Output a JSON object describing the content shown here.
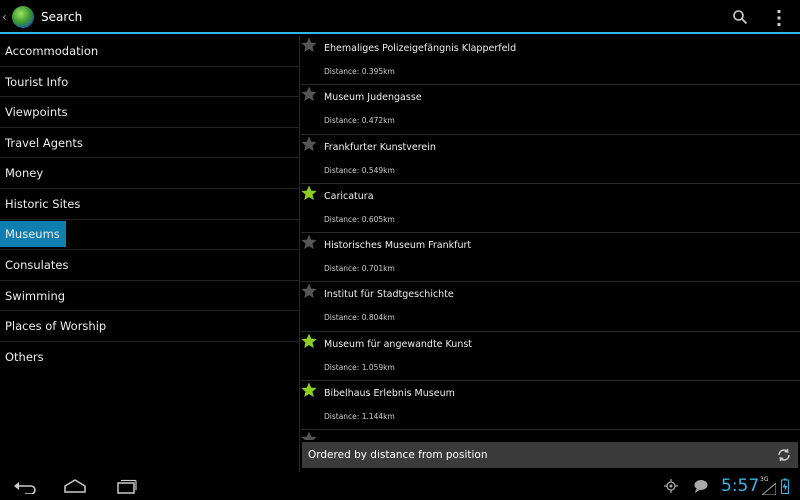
{
  "actionbar": {
    "title": "Search",
    "icons": [
      "up-chevron-icon",
      "globe-logo-icon",
      "search-icon",
      "overflow-menu-icon"
    ]
  },
  "categories": [
    {
      "label": "Accommodation",
      "selected": false
    },
    {
      "label": "Tourist Info",
      "selected": false
    },
    {
      "label": "Viewpoints",
      "selected": false
    },
    {
      "label": "Travel Agents",
      "selected": false
    },
    {
      "label": "Money",
      "selected": false
    },
    {
      "label": "Historic Sites",
      "selected": false
    },
    {
      "label": "Museums",
      "selected": true
    },
    {
      "label": "Consulates",
      "selected": false
    },
    {
      "label": "Swimming",
      "selected": false
    },
    {
      "label": "Places of Worship",
      "selected": false
    },
    {
      "label": "Others",
      "selected": false
    }
  ],
  "pois": [
    {
      "name": "Ehemaliges Polizeigefängnis Klapperfeld",
      "distance": "Distance: 0.395km",
      "favorite": false
    },
    {
      "name": "Museum Judengasse",
      "distance": "Distance: 0.472km",
      "favorite": false
    },
    {
      "name": "Frankfurter Kunstverein",
      "distance": "Distance: 0.549km",
      "favorite": false
    },
    {
      "name": "Caricatura",
      "distance": "Distance: 0.605km",
      "favorite": true
    },
    {
      "name": "Historisches Museum Frankfurt",
      "distance": "Distance: 0.701km",
      "favorite": false
    },
    {
      "name": "Institut für Stadtgeschichte",
      "distance": "Distance: 0.804km",
      "favorite": false
    },
    {
      "name": "Museum für angewandte Kunst",
      "distance": "Distance: 1.059km",
      "favorite": true
    },
    {
      "name": "Bibelhaus Erlebnis Museum",
      "distance": "Distance: 1.144km",
      "favorite": true
    },
    {
      "name": "",
      "distance": "",
      "favorite": false
    }
  ],
  "sortbar": {
    "label": "Ordered by distance from position",
    "icon": "refresh-icon"
  },
  "navbar": {
    "clock": "5:57",
    "network": "3G"
  },
  "colors": {
    "accent": "#33b5e5",
    "selected_bg": "#0e7fae",
    "star_on": "#8cd01d",
    "star_off": "#555555",
    "sortbar_bg": "#3a3a3a"
  }
}
